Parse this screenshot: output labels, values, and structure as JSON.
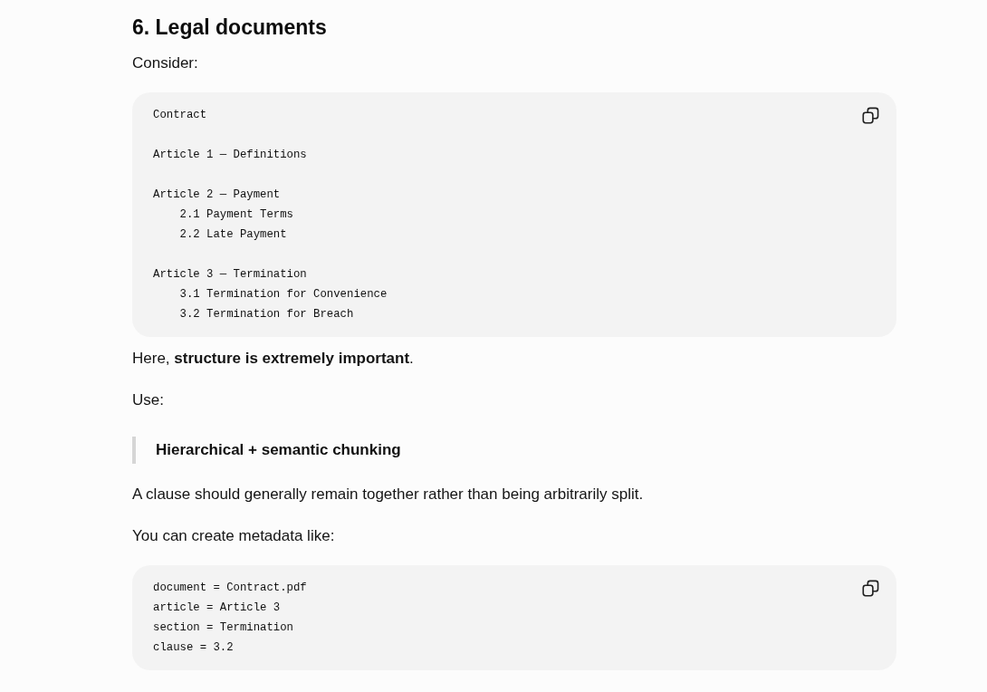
{
  "section": {
    "heading": "6. Legal documents",
    "blocks": [
      {
        "kind": "paragraph",
        "text": "Consider:"
      },
      {
        "kind": "code",
        "groups": [
          {
            "lines": [
              {
                "text": "Contract"
              }
            ]
          },
          {
            "lines": [
              {
                "text": "Article 1 — Definitions"
              }
            ]
          },
          {
            "lines": [
              {
                "text": "Article 2 — Payment",
                "children": [
                  {
                    "text": "2.1 Payment Terms"
                  },
                  {
                    "text": "2.2 Late Payment"
                  }
                ]
              }
            ]
          },
          {
            "lines": [
              {
                "text": "Article 3 — Termination",
                "children": [
                  {
                    "text": "3.1 Termination for Convenience"
                  },
                  {
                    "text": "3.2 Termination for Breach"
                  }
                ]
              }
            ]
          }
        ]
      },
      {
        "kind": "paragraph",
        "text": "Here, **structure is extremely important**."
      },
      {
        "kind": "paragraph",
        "text": "Use:"
      },
      {
        "kind": "quote",
        "text": "Hierarchical + semantic chunking"
      },
      {
        "kind": "paragraph",
        "text": "A clause should generally remain together rather than being arbitrarily split."
      },
      {
        "kind": "paragraph",
        "text": "You can create metadata like:"
      },
      {
        "kind": "code",
        "groups": [
          {
            "lines": [
              {
                "text": "document = Contract.pdf"
              },
              {
                "text": "article = Article 3"
              },
              {
                "text": "section = Termination"
              },
              {
                "text": "clause = 3.2"
              }
            ]
          }
        ]
      }
    ]
  }
}
